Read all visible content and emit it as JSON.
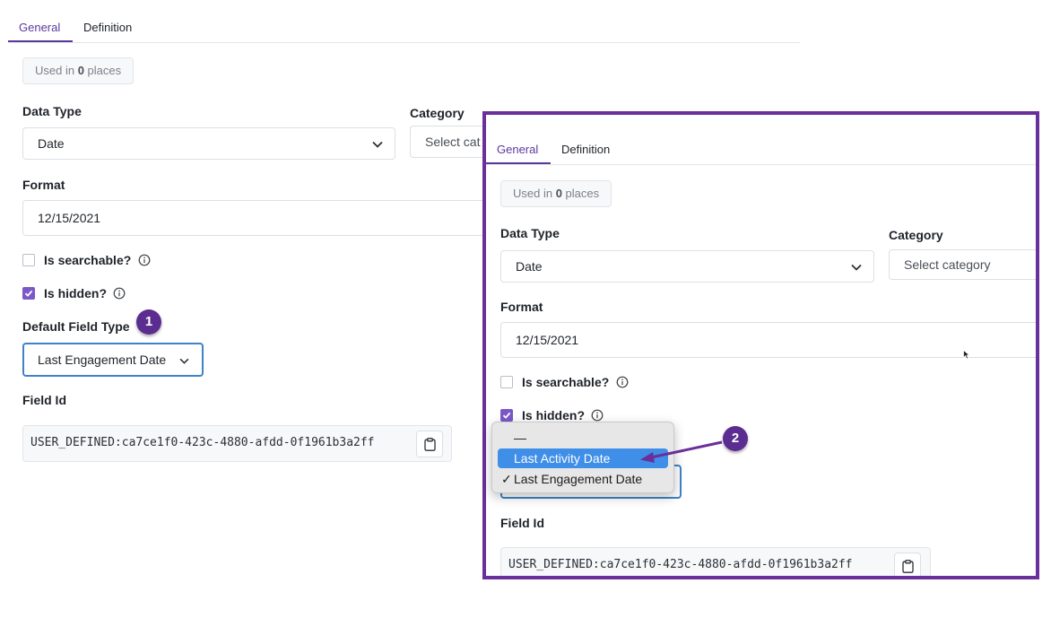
{
  "tabs": [
    {
      "label": "General",
      "active": true
    },
    {
      "label": "Definition",
      "active": false
    }
  ],
  "usage_badge": {
    "prefix": "Used in ",
    "count": "0",
    "suffix": " places"
  },
  "data_type": {
    "label": "Data Type",
    "value": "Date"
  },
  "category": {
    "label": "Category",
    "placeholder_left": "Select cat",
    "placeholder": "Select category"
  },
  "format": {
    "label": "Format",
    "value": "12/15/2021"
  },
  "searchable": {
    "label": "Is searchable?",
    "checked": false
  },
  "hidden": {
    "label": "Is hidden?",
    "checked": true
  },
  "default_field_type": {
    "label": "Default Field Type",
    "value": "Last Engagement Date"
  },
  "field_id": {
    "label": "Field Id",
    "value": "USER_DEFINED:ca7ce1f0-423c-4880-afdd-0f1961b3a2ff"
  },
  "dropdown_menu": {
    "items": [
      {
        "label": "—",
        "selected": false,
        "highlighted": false
      },
      {
        "label": "Last Activity Date",
        "selected": false,
        "highlighted": true
      },
      {
        "label": "Last Engagement Date",
        "selected": true,
        "highlighted": false
      }
    ],
    "check_glyph": "✓"
  },
  "callouts": [
    "1",
    "2"
  ],
  "colors": {
    "accent": "#5b3a9c",
    "checkbox": "#7b58c9",
    "callout": "#5c2d91",
    "panel_border": "#6a2f9a",
    "menu_highlight": "#3f8ee8",
    "focus": "#3d84c6"
  },
  "icons": [
    "chevron-down-icon",
    "info-icon",
    "check-icon",
    "clipboard-icon",
    "cursor-icon",
    "arrow-icon"
  ]
}
